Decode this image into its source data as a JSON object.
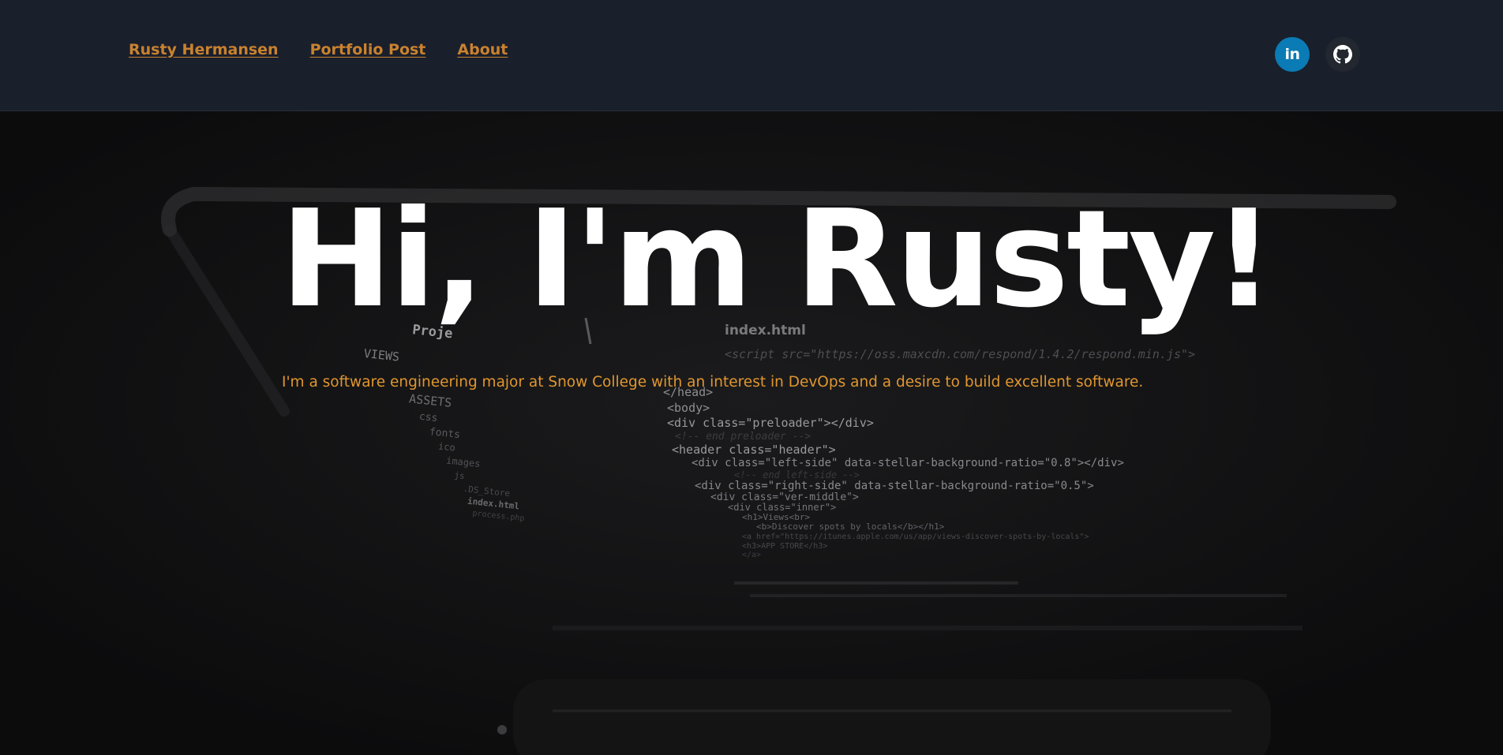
{
  "nav": {
    "links": [
      {
        "label": "Rusty Hermansen"
      },
      {
        "label": "Portfolio Post"
      },
      {
        "label": "About"
      }
    ],
    "socials": [
      {
        "name": "linkedin-icon",
        "color": "#0a7bb4",
        "glyph": "in"
      },
      {
        "name": "github-icon",
        "color": "#23272f"
      }
    ]
  },
  "hero": {
    "title": "Hi, I'm Rusty!",
    "subtitle": "I'm a software engineering major at Snow College with an interest in DevOps and a desire to build excellent software."
  },
  "background": {
    "sidebar": [
      "Proje",
      "VIEWS",
      "ASSETS",
      "css",
      "fonts",
      "ico",
      "images",
      "js",
      ".DS_Store",
      "index.html",
      "process.php"
    ],
    "tab": "index.html",
    "code_lines": [
      "<script src=\"https://oss.maxcdn.com/respond/1.4.2/respond.min.js\">",
      "</head>",
      "<body>",
      "<div class=\"preloader\"></div>",
      "<!-- end preloader -->",
      "<header class=\"header\">",
      "<div class=\"left-side\" data-stellar-background-ratio=\"0.8\"></div>",
      "<!-- end left-side -->",
      "<div class=\"right-side\" data-stellar-background-ratio=\"0.5\">",
      "<div class=\"ver-middle\">",
      "<div class=\"inner\">",
      "<h1>Views<br>",
      "<b>Discover spots by locals</b></h1>",
      "<a href=\"https://itunes.apple.com/us/app/views-discover-spots-by-locals\">",
      "<h3>APP STORE</h3>",
      "</a>"
    ]
  },
  "colors": {
    "nav_bg": "#1a1f2c",
    "nav_link": "#c9822e",
    "subtitle": "#e0962f",
    "hero_bg": "#0e0e0f"
  }
}
